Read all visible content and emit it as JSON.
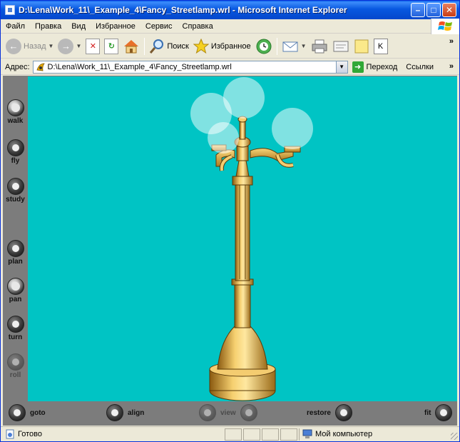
{
  "window": {
    "title": "D:\\Lena\\Work_11\\_Example_4\\Fancy_Streetlamp.wrl - Microsoft Internet Explorer"
  },
  "menu": [
    "Файл",
    "Правка",
    "Вид",
    "Избранное",
    "Сервис",
    "Справка"
  ],
  "toolbar": {
    "back_label": "Назад",
    "search_label": "Поиск",
    "favorites_label": "Избранное",
    "more": "»"
  },
  "address": {
    "label": "Адрес:",
    "value": "D:\\Lena\\Work_11\\_Example_4\\Fancy_Streetlamp.wrl",
    "go_label": "Переход",
    "links_label": "Ссылки",
    "more": "»"
  },
  "viewer": {
    "background_color": "#00c4c4",
    "side_tools": [
      {
        "label": "walk",
        "enabled": true
      },
      {
        "label": "fly",
        "enabled": true
      },
      {
        "label": "study",
        "enabled": true
      },
      {
        "label": "plan",
        "enabled": true
      },
      {
        "label": "pan",
        "enabled": true
      },
      {
        "label": "turn",
        "enabled": true
      },
      {
        "label": "roll",
        "enabled": false
      }
    ],
    "bottom_tools": {
      "goto": "goto",
      "align": "align",
      "view": "view",
      "restore": "restore",
      "fit": "fit"
    }
  },
  "status": {
    "text": "Готово",
    "zone": "Мой компьютер"
  }
}
